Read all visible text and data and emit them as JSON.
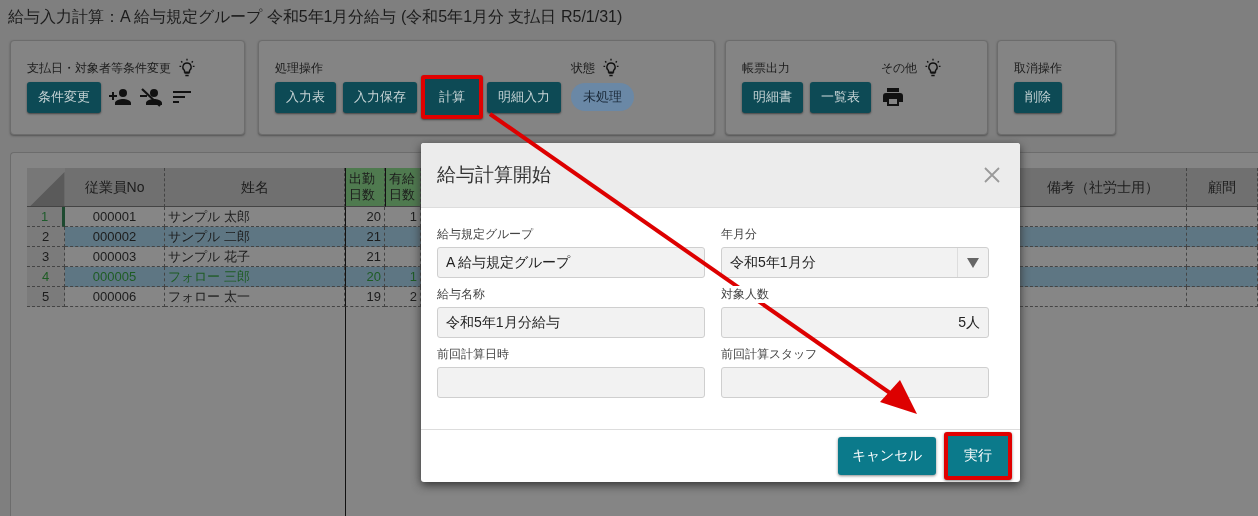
{
  "title": "給与入力計算：A 給与規定グループ 令和5年1月分給与 (令和5年1月分 支払日 R5/1/31)",
  "panels": [
    {
      "groups": [
        {
          "label": "支払日・対象者等条件変更",
          "help": true,
          "items": [
            {
              "kind": "button",
              "label": "条件変更",
              "highlighted": false
            },
            {
              "kind": "add-person"
            },
            {
              "kind": "remove-person"
            },
            {
              "kind": "sort"
            }
          ]
        }
      ]
    },
    {
      "groups": [
        {
          "label": "処理操作",
          "help": false,
          "items": [
            {
              "kind": "button",
              "label": "入力表",
              "highlighted": false
            },
            {
              "kind": "button",
              "label": "入力保存",
              "highlighted": false
            },
            {
              "kind": "button",
              "label": "計算",
              "highlighted": true
            },
            {
              "kind": "button",
              "label": "明細入力",
              "highlighted": false
            }
          ]
        },
        {
          "label": "状態",
          "help": true,
          "items": [
            {
              "kind": "status",
              "label": "未処理"
            }
          ]
        }
      ]
    },
    {
      "groups": [
        {
          "label": "帳票出力",
          "help": false,
          "items": [
            {
              "kind": "button",
              "label": "明細書",
              "highlighted": false
            },
            {
              "kind": "button",
              "label": "一覧表",
              "highlighted": false
            }
          ]
        },
        {
          "label": "その他",
          "help": true,
          "items": [
            {
              "kind": "print"
            }
          ]
        }
      ]
    },
    {
      "groups": [
        {
          "label": "取消操作",
          "help": false,
          "items": [
            {
              "kind": "button",
              "label": "削除",
              "highlighted": false
            }
          ]
        }
      ]
    }
  ],
  "table": {
    "columns": [
      {
        "label": "従業員No",
        "accent": false
      },
      {
        "label": "姓名",
        "accent": false
      },
      {
        "label": "出勤日数",
        "accent": true
      },
      {
        "label": "有給日数",
        "accent": true
      },
      {
        "label": "備考（社労士用）",
        "accent": false
      },
      {
        "label": "顧問",
        "accent": false
      }
    ],
    "rows": [
      {
        "number": "1",
        "current": true,
        "selected": false,
        "emphasized": false,
        "cells": [
          "000001",
          "サンプル 太郎",
          "20",
          "1"
        ]
      },
      {
        "number": "2",
        "current": false,
        "selected": true,
        "emphasized": false,
        "cells": [
          "000002",
          "サンプル 二郎",
          "21"
        ]
      },
      {
        "number": "3",
        "current": false,
        "selected": false,
        "emphasized": false,
        "cells": [
          "000003",
          "サンプル 花子",
          "21"
        ]
      },
      {
        "number": "4",
        "current": false,
        "selected": true,
        "emphasized": true,
        "cells": [
          "000005",
          "フォロー 三郎",
          "20",
          "1"
        ]
      },
      {
        "number": "5",
        "current": false,
        "selected": false,
        "emphasized": false,
        "cells": [
          "000006",
          "フォロー 太一",
          "19",
          "2"
        ]
      }
    ]
  },
  "dialog": {
    "title": "給与計算開始",
    "fields": [
      {
        "label": "給与規定グループ",
        "kind": "text",
        "value": "A 給与規定グループ"
      },
      {
        "label": "年月分",
        "kind": "select",
        "value": "令和5年1月分"
      },
      {
        "label": "給与名称",
        "kind": "text",
        "value": "令和5年1月分給与"
      },
      {
        "label": "対象人数",
        "kind": "number",
        "value": "5人"
      },
      {
        "label": "前回計算日時",
        "kind": "text"
      },
      {
        "label": "前回計算スタッフ",
        "kind": "text"
      }
    ],
    "buttons": [
      {
        "label": "キャンセル",
        "highlighted": false
      },
      {
        "label": "実行",
        "highlighted": true
      }
    ]
  }
}
